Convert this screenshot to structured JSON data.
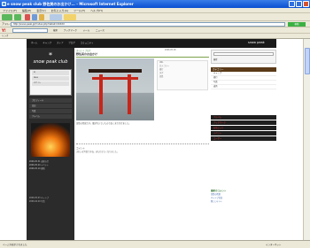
{
  "window": {
    "title": "e snow peak club 野佐美のお出かけ... - Microsoft Internet Explorer"
  },
  "menubar": [
    "ファイル(F)",
    "編集(E)",
    "表示(V)",
    "お気に入り(A)",
    "ツール(T)",
    "ヘルプ(H)"
  ],
  "address": {
    "label": "アドレス",
    "value": "http://snow-peak.jp/?index.php?detail=XXXXX",
    "go_label": "移動"
  },
  "linksbar": {
    "yahoo_label": "Y!",
    "items": [
      "検索",
      "ブックマーク",
      "メール",
      "ニュース"
    ],
    "row2": "リンク"
  },
  "site": {
    "logo": "snow peak",
    "nav": [
      "ホーム",
      "キャンプ",
      "ストア",
      "ブログ",
      "コミュニティ"
    ]
  },
  "left": {
    "brand_mark": "*",
    "brand_name": "snow peak club",
    "login": [
      "ID",
      "PASS",
      "ログイン"
    ],
    "menu": [
      "プロフィール",
      "日記",
      "写真",
      "アルバム",
      "ブックマーク"
    ],
    "news": [
      "2006.05.31 お知らせ",
      "2006.05.20 イベント",
      "2006.05.10 更新"
    ],
    "footer": [
      "2006.05.03 キャンプ",
      "2006.04.29 写真"
    ]
  },
  "main": {
    "crumb": "ホーム > ブログ",
    "meta": "2006.05.18",
    "title": "野佐美のお出かけ",
    "caption": "宮島の鳥居です。潮が引いていたので近くまで行けました。",
    "sidebox": [
      "URL",
      "カテゴリー",
      "旅行",
      "タグ",
      "宮島"
    ],
    "comment_header": "コメント",
    "comment_body": "きれいな写真ですね。また行きたくなりました。"
  },
  "right": {
    "search_label": "検索",
    "categories_header": "カテゴリー",
    "categories": [
      "キャンプ",
      "旅行",
      "写真",
      "道具"
    ],
    "links": [
      "アルバム",
      "ブックマーク",
      "お気に入り",
      "イベント",
      "ユーザー"
    ],
    "recent_header": "最新のコメント",
    "recent": [
      "宮島の鳥居",
      "キャンプ日記",
      "新しいテント"
    ]
  },
  "status": {
    "text": "ページが表示されました",
    "zone": "インターネット"
  }
}
